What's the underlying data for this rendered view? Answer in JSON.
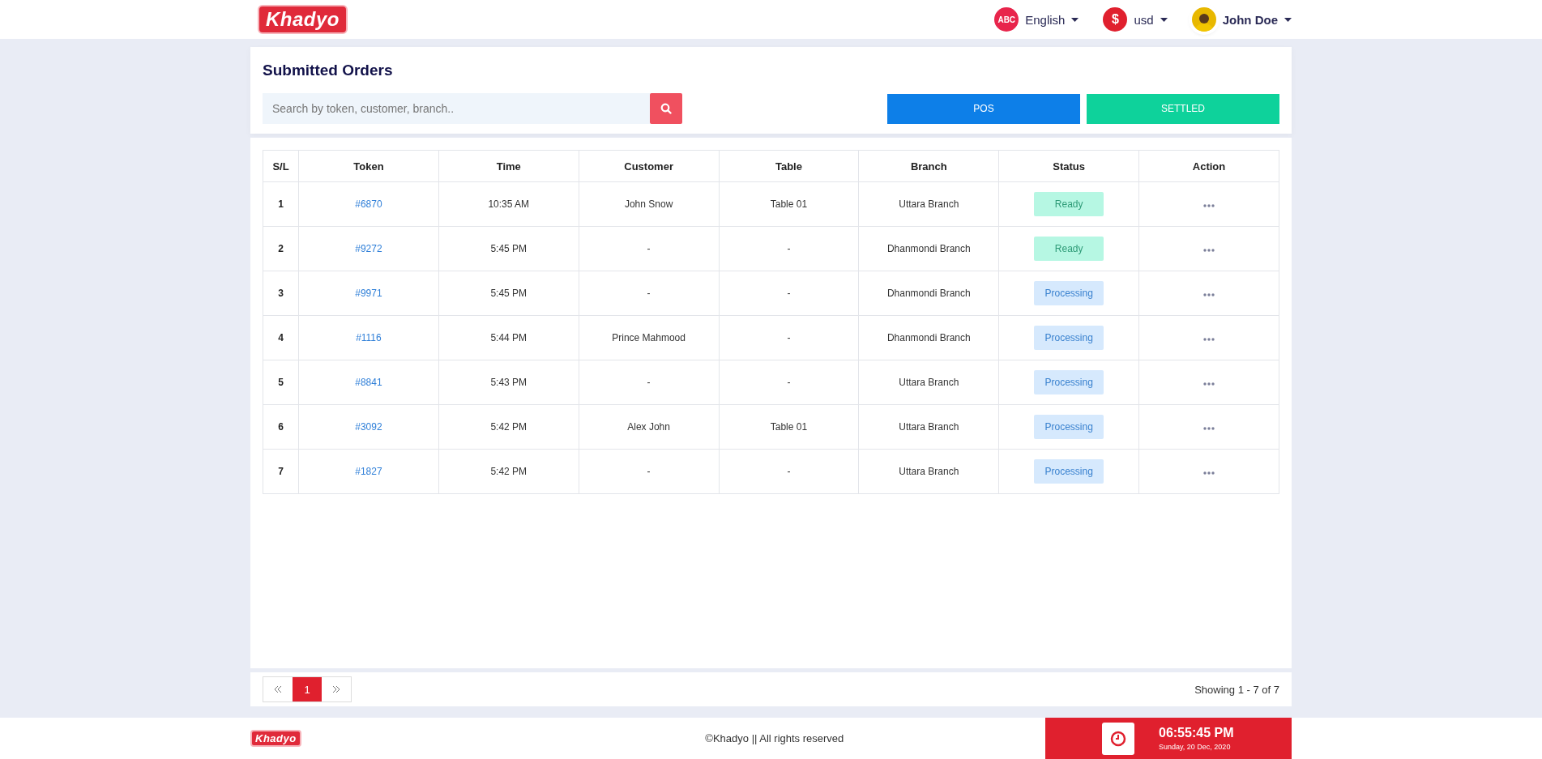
{
  "header": {
    "logo": "Khadyo",
    "language": {
      "badge": "ABC",
      "label": "English"
    },
    "currency": {
      "badge": "$",
      "label": "usd"
    },
    "user": {
      "name": "John Doe"
    }
  },
  "title": "Submitted Orders",
  "search": {
    "placeholder": "Search by token, customer, branch.."
  },
  "buttons": [
    {
      "label": "POS",
      "kind": "primary"
    },
    {
      "label": "SETTLED",
      "kind": "success"
    }
  ],
  "table": {
    "columns": [
      "S/L",
      "Token",
      "Time",
      "Customer",
      "Table",
      "Branch",
      "Status",
      "Action"
    ],
    "rows": [
      {
        "sl": "1",
        "token": "#6870",
        "time": "10:35 AM",
        "customer": "John Snow",
        "table": "Table 01",
        "branch": "Uttara Branch",
        "status": {
          "label": "Ready",
          "kind": "ready"
        }
      },
      {
        "sl": "2",
        "token": "#9272",
        "time": "5:45 PM",
        "customer": "-",
        "table": "-",
        "branch": "Dhanmondi Branch",
        "status": {
          "label": "Ready",
          "kind": "ready"
        }
      },
      {
        "sl": "3",
        "token": "#9971",
        "time": "5:45 PM",
        "customer": "-",
        "table": "-",
        "branch": "Dhanmondi Branch",
        "status": {
          "label": "Processing",
          "kind": "processing"
        }
      },
      {
        "sl": "4",
        "token": "#1116",
        "time": "5:44 PM",
        "customer": "Prince Mahmood",
        "table": "-",
        "branch": "Dhanmondi Branch",
        "status": {
          "label": "Processing",
          "kind": "processing"
        }
      },
      {
        "sl": "5",
        "token": "#8841",
        "time": "5:43 PM",
        "customer": "-",
        "table": "-",
        "branch": "Uttara Branch",
        "status": {
          "label": "Processing",
          "kind": "processing"
        }
      },
      {
        "sl": "6",
        "token": "#3092",
        "time": "5:42 PM",
        "customer": "Alex John",
        "table": "Table 01",
        "branch": "Uttara Branch",
        "status": {
          "label": "Processing",
          "kind": "processing"
        }
      },
      {
        "sl": "7",
        "token": "#1827",
        "time": "5:42 PM",
        "customer": "-",
        "table": "-",
        "branch": "Uttara Branch",
        "status": {
          "label": "Processing",
          "kind": "processing"
        }
      }
    ]
  },
  "pagination": {
    "pages": [
      {
        "label": "1",
        "selected": true
      }
    ],
    "summary": "Showing 1 - 7 of 7"
  },
  "footer": {
    "logo": "Khadyo",
    "copyright": "©Khadyo || All rights reserved",
    "time": "06:55:45 PM",
    "date": "Sunday, 20 Dec, 2020"
  }
}
